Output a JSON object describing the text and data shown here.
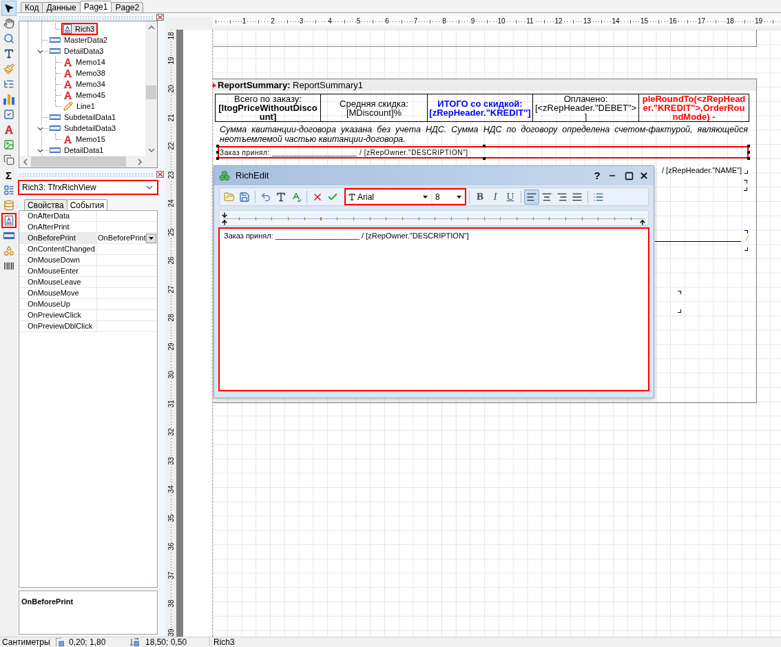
{
  "toolbar": {
    "tools": [
      {
        "kind": "pointer",
        "selected": true,
        "highlighted": false
      },
      {
        "kind": "hand",
        "selected": false,
        "highlighted": false
      },
      {
        "kind": "zoom",
        "selected": false,
        "highlighted": false
      },
      {
        "kind": "text",
        "selected": false,
        "highlighted": false
      },
      {
        "kind": "brush",
        "selected": false,
        "highlighted": false
      },
      {
        "kind": "connector",
        "selected": false,
        "highlighted": false
      },
      {
        "kind": "chart",
        "selected": false,
        "highlighted": false
      },
      {
        "kind": "checkbox",
        "selected": false,
        "highlighted": false
      },
      {
        "kind": "memo",
        "selected": false,
        "highlighted": false
      },
      {
        "kind": "picture",
        "selected": false,
        "highlighted": false
      },
      {
        "kind": "page",
        "selected": false,
        "highlighted": false
      },
      {
        "kind": "sum",
        "label": "Σ",
        "selected": false,
        "highlighted": false
      },
      {
        "kind": "report",
        "selected": false,
        "highlighted": false
      },
      {
        "kind": "database",
        "selected": false,
        "highlighted": false
      },
      {
        "kind": "rich",
        "selected": false,
        "highlighted": true
      },
      {
        "kind": "band",
        "selected": false,
        "highlighted": false
      },
      {
        "kind": "shapes",
        "selected": false,
        "highlighted": false
      },
      {
        "kind": "barcode",
        "selected": false,
        "highlighted": false
      }
    ]
  },
  "tabs": [
    {
      "label": "Код",
      "selected": false
    },
    {
      "label": "Данные",
      "selected": false
    },
    {
      "label": "Page1",
      "selected": true
    },
    {
      "label": "Page2",
      "selected": false
    }
  ],
  "tree": {
    "continued_children": [
      {
        "label": "Rich3",
        "kind": "rich",
        "selected": true
      }
    ],
    "items": [
      {
        "label": "MasterData2",
        "kind": "band",
        "selected": false
      },
      {
        "label": "DetailData3",
        "kind": "band",
        "selected": false,
        "expanded": true,
        "children": [
          {
            "label": "Memo14",
            "kind": "memo",
            "selected": false
          },
          {
            "label": "Memo38",
            "kind": "memo",
            "selected": false
          },
          {
            "label": "Memo34",
            "kind": "memo",
            "selected": false
          },
          {
            "label": "Memo45",
            "kind": "memo",
            "selected": false
          },
          {
            "label": "Line1",
            "kind": "line",
            "selected": false
          }
        ]
      },
      {
        "label": "SubdetailData1",
        "kind": "band",
        "selected": false
      },
      {
        "label": "SubdetailData3",
        "kind": "band",
        "selected": false,
        "expanded": true,
        "children": [
          {
            "label": "Memo15",
            "kind": "memo",
            "selected": false
          }
        ]
      },
      {
        "label": "DetailData1",
        "kind": "band",
        "selected": false,
        "expanded": true
      }
    ]
  },
  "inspector": {
    "object": "Rich3: TfrxRichView",
    "highlighted": true,
    "tabs": [
      {
        "label": "Свойства",
        "selected": false
      },
      {
        "label": "События",
        "selected": true
      }
    ],
    "rows": [
      {
        "name": "OnAfterData",
        "selected": false
      },
      {
        "name": "OnAfterPrint",
        "selected": false
      },
      {
        "name": "OnBeforePrint",
        "value": "OnBeforePrint",
        "selected": true
      },
      {
        "name": "OnContentChanged",
        "selected": false
      },
      {
        "name": "OnMouseDown",
        "selected": false
      },
      {
        "name": "OnMouseEnter",
        "selected": false
      },
      {
        "name": "OnMouseLeave",
        "selected": false
      },
      {
        "name": "OnMouseMove",
        "selected": false
      },
      {
        "name": "OnMouseUp",
        "selected": false
      },
      {
        "name": "OnPreviewClick",
        "selected": false
      },
      {
        "name": "OnPreviewDblClick",
        "selected": false
      }
    ],
    "description": "OnBeforePrint"
  },
  "rulers": {
    "horizontal": [
      "1",
      "2",
      "3",
      "4",
      "5",
      "6",
      "7",
      "8",
      "9",
      "10",
      "11",
      "12",
      "13",
      "14",
      "15",
      "16",
      "17",
      "18",
      "19"
    ],
    "vertical": [
      "18",
      "19",
      "20",
      "21",
      "22",
      "23",
      "24",
      "25",
      "26",
      "27",
      "28",
      "29",
      "30",
      "31",
      "32",
      "33",
      "34",
      "35",
      "36",
      "37",
      "38",
      "39"
    ]
  },
  "report": {
    "summary_band": {
      "type": "ReportSummary:",
      "name": "ReportSummary1",
      "cells": [
        {
          "text": "Всего по заказу: **[ItogPriceWithoutDiscount]**",
          "color": "#000000",
          "bold": false
        },
        {
          "text": "Средняя скидка: [MDiscount]%",
          "color": "#000000",
          "bold": false
        },
        {
          "text": "ИТОГО со скидкой: [zRepHeader.\"KREDIT\"]",
          "color": "#0000ff",
          "bold": true
        },
        {
          "text": "Оплачено: [<zRepHeader.\"DEBET\">]",
          "color": "#000000",
          "bold": false
        },
        {
          "text": "pleRoundTo(<zRepHeader.\"KREDIT\">,OrderRoundMode) -",
          "color": "#ff0000",
          "bold": true
        }
      ],
      "note": "Сумма квитанции-договора указана без учета НДС. Сумма НДС по договору определена счетом-фактурой, являющейся неотъемлемой частью квитанции-договора.",
      "rich_memo": {
        "text": "Заказ принял: ____________________ / [zRepOwner.\"DESCRIPTION\"]",
        "selected": true,
        "highlighted": true
      },
      "partly_covered_memo": {
        "text": "/ [zRepHeader.\"NAME\"]"
      },
      "partly_covered_slash": {
        "text": "/"
      }
    }
  },
  "rich_edit": {
    "title": "RichEdit",
    "help": "?",
    "tools": [
      {
        "kind": "open"
      },
      {
        "kind": "save"
      },
      {
        "kind": "separator"
      },
      {
        "kind": "undo"
      },
      {
        "kind": "font"
      },
      {
        "kind": "spellcheck"
      },
      {
        "kind": "separator"
      },
      {
        "kind": "cancel"
      },
      {
        "kind": "apply"
      }
    ],
    "font_group": {
      "font": "Arial",
      "size": "8",
      "highlighted": true
    },
    "format_tools": [
      {
        "kind": "separator"
      },
      {
        "kind": "bold",
        "label": "B",
        "selected": false
      },
      {
        "kind": "italic",
        "label": "I",
        "selected": false
      },
      {
        "kind": "underline",
        "label": "U",
        "selected": false
      },
      {
        "kind": "separator"
      },
      {
        "kind": "align_left",
        "selected": true
      },
      {
        "kind": "align_center",
        "selected": false
      },
      {
        "kind": "align_right",
        "selected": false
      },
      {
        "kind": "align_justify",
        "selected": false
      },
      {
        "kind": "separator"
      },
      {
        "kind": "bullets",
        "selected": false
      }
    ],
    "text": "Заказ принял: ____________________ / [zRepOwner.\"DESCRIPTION\"]",
    "text_highlighted": true
  },
  "status_bar": {
    "units": "Сантиметры",
    "position": "0,20; 1,80",
    "size": "18,50; 0,50",
    "object": "Rich3"
  }
}
